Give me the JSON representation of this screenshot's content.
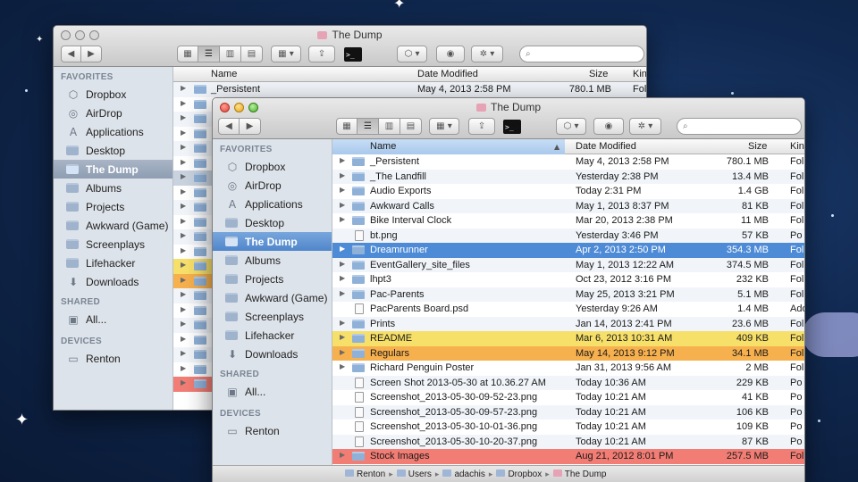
{
  "background": {
    "color": "#10284f",
    "star_color": "#ffffff"
  },
  "back_window": {
    "title": "The Dump",
    "toolbar": {
      "nav_back": "◀",
      "nav_fwd": "▶",
      "view_icons": "▦",
      "view_list": "☰",
      "view_columns": "▥",
      "view_flow": "▤",
      "arrange": "▦ ▾",
      "share": "⇪",
      "terminal": ">_",
      "dropbox": "⬡ ▾",
      "quicklook": "◉",
      "action": "✲ ▾",
      "search_placeholder": ""
    },
    "sidebar": {
      "favorites_header": "FAVORITES",
      "favorites": [
        {
          "label": "Dropbox",
          "icon": "dropbox-icon"
        },
        {
          "label": "AirDrop",
          "icon": "airdrop-icon"
        },
        {
          "label": "Applications",
          "icon": "applications-icon"
        },
        {
          "label": "Desktop",
          "icon": "desktop-icon"
        },
        {
          "label": "The Dump",
          "icon": "folder-icon",
          "selected": true
        },
        {
          "label": "Albums",
          "icon": "folder-icon"
        },
        {
          "label": "Projects",
          "icon": "folder-icon"
        },
        {
          "label": "Awkward (Game)",
          "icon": "folder-icon"
        },
        {
          "label": "Screenplays",
          "icon": "folder-icon"
        },
        {
          "label": "Lifehacker",
          "icon": "folder-icon"
        },
        {
          "label": "Downloads",
          "icon": "downloads-icon"
        }
      ],
      "shared_header": "SHARED",
      "shared": [
        {
          "label": "All...",
          "icon": "network-icon"
        }
      ],
      "devices_header": "DEVICES",
      "devices": [
        {
          "label": "Renton",
          "icon": "computer-icon"
        }
      ]
    },
    "columns": {
      "name": "Name",
      "date": "Date Modified",
      "size": "Size",
      "kind": "Kin"
    },
    "first_row": {
      "name": "_Persistent",
      "date": "May 4, 2013 2:58 PM",
      "size": "780.1 MB",
      "kind": "Fold"
    }
  },
  "front_window": {
    "title": "The Dump",
    "toolbar": {
      "nav_back": "◀",
      "nav_fwd": "▶",
      "view_icons": "▦",
      "view_list": "☰",
      "view_columns": "▥",
      "view_flow": "▤",
      "arrange": "▦ ▾",
      "share": "⇪",
      "terminal": ">_",
      "dropbox": "⬡ ▾",
      "quicklook": "◉",
      "action": "✲ ▾",
      "search_placeholder": ""
    },
    "sidebar": {
      "favorites_header": "FAVORITES",
      "favorites": [
        {
          "label": "Dropbox",
          "icon": "dropbox-icon"
        },
        {
          "label": "AirDrop",
          "icon": "airdrop-icon"
        },
        {
          "label": "Applications",
          "icon": "applications-icon"
        },
        {
          "label": "Desktop",
          "icon": "desktop-icon"
        },
        {
          "label": "The Dump",
          "icon": "folder-icon",
          "selected": true
        },
        {
          "label": "Albums",
          "icon": "folder-icon"
        },
        {
          "label": "Projects",
          "icon": "folder-icon"
        },
        {
          "label": "Awkward (Game)",
          "icon": "folder-icon"
        },
        {
          "label": "Screenplays",
          "icon": "folder-icon"
        },
        {
          "label": "Lifehacker",
          "icon": "folder-icon"
        },
        {
          "label": "Downloads",
          "icon": "downloads-icon"
        }
      ],
      "shared_header": "SHARED",
      "shared": [
        {
          "label": "All...",
          "icon": "network-icon"
        }
      ],
      "devices_header": "DEVICES",
      "devices": [
        {
          "label": "Renton",
          "icon": "computer-icon"
        }
      ]
    },
    "columns": {
      "name": "Name",
      "date": "Date Modified",
      "size": "Size",
      "kind": "Kin"
    },
    "rows": [
      {
        "name": "_Persistent",
        "date": "May 4, 2013 2:58 PM",
        "size": "780.1 MB",
        "kind": "Fol",
        "type": "folder",
        "expandable": true
      },
      {
        "name": "_The Landfill",
        "date": "Yesterday 2:38 PM",
        "size": "13.4 MB",
        "kind": "Fol",
        "type": "folder",
        "expandable": true
      },
      {
        "name": "Audio Exports",
        "date": "Today 2:31 PM",
        "size": "1.4 GB",
        "kind": "Fol",
        "type": "folder",
        "expandable": true
      },
      {
        "name": "Awkward Calls",
        "date": "May 1, 2013 8:37 PM",
        "size": "81 KB",
        "kind": "Fol",
        "type": "folder",
        "expandable": true
      },
      {
        "name": "Bike Interval Clock",
        "date": "Mar 20, 2013 2:38 PM",
        "size": "11 MB",
        "kind": "Fol",
        "type": "folder",
        "expandable": true
      },
      {
        "name": "bt.png",
        "date": "Yesterday 3:46 PM",
        "size": "57 KB",
        "kind": "Po",
        "type": "file",
        "expandable": false
      },
      {
        "name": "Dreamrunner",
        "date": "Apr 2, 2013 2:50 PM",
        "size": "354.3 MB",
        "kind": "Fol",
        "type": "folder",
        "expandable": true,
        "state": "sel"
      },
      {
        "name": "EventGallery_site_files",
        "date": "May 1, 2013 12:22 AM",
        "size": "374.5 MB",
        "kind": "Fol",
        "type": "folder",
        "expandable": true
      },
      {
        "name": "lhpt3",
        "date": "Oct 23, 2012 3:16 PM",
        "size": "232 KB",
        "kind": "Fol",
        "type": "folder",
        "expandable": true
      },
      {
        "name": "Pac-Parents",
        "date": "May 25, 2013 3:21 PM",
        "size": "5.1 MB",
        "kind": "Fol",
        "type": "folder",
        "expandable": true
      },
      {
        "name": "PacParents Board.psd",
        "date": "Yesterday 9:26 AM",
        "size": "1.4 MB",
        "kind": "Ado",
        "type": "file",
        "expandable": false
      },
      {
        "name": "Prints",
        "date": "Jan 14, 2013 2:41 PM",
        "size": "23.6 MB",
        "kind": "Fol",
        "type": "folder",
        "expandable": true
      },
      {
        "name": "README",
        "date": "Mar 6, 2013 10:31 AM",
        "size": "409 KB",
        "kind": "Fol",
        "type": "folder",
        "expandable": true,
        "state": "label-yellow"
      },
      {
        "name": "Regulars",
        "date": "May 14, 2013 9:12 PM",
        "size": "34.1 MB",
        "kind": "Fol",
        "type": "folder",
        "expandable": true,
        "state": "label-orange"
      },
      {
        "name": "Richard Penguin Poster",
        "date": "Jan 31, 2013 9:56 AM",
        "size": "2 MB",
        "kind": "Fol",
        "type": "folder",
        "expandable": true
      },
      {
        "name": "Screen Shot 2013-05-30 at 10.36.27 AM",
        "date": "Today 10:36 AM",
        "size": "229 KB",
        "kind": "Po",
        "type": "file",
        "expandable": false
      },
      {
        "name": "Screenshot_2013-05-30-09-52-23.png",
        "date": "Today 10:21 AM",
        "size": "41 KB",
        "kind": "Po",
        "type": "file",
        "expandable": false
      },
      {
        "name": "Screenshot_2013-05-30-09-57-23.png",
        "date": "Today 10:21 AM",
        "size": "106 KB",
        "kind": "Po",
        "type": "file",
        "expandable": false
      },
      {
        "name": "Screenshot_2013-05-30-10-01-36.png",
        "date": "Today 10:21 AM",
        "size": "109 KB",
        "kind": "Po",
        "type": "file",
        "expandable": false
      },
      {
        "name": "Screenshot_2013-05-30-10-20-37.png",
        "date": "Today 10:21 AM",
        "size": "87 KB",
        "kind": "Po",
        "type": "file",
        "expandable": false
      },
      {
        "name": "Stock Images",
        "date": "Aug 21, 2012 8:01 PM",
        "size": "257.5 MB",
        "kind": "Fol",
        "type": "folder",
        "expandable": true,
        "state": "label-red"
      }
    ],
    "pathbar": [
      "Renton",
      "Users",
      "adachis",
      "Dropbox",
      "The Dump"
    ]
  },
  "colors": {
    "selection": "#4e8bd6",
    "label_yellow": "#f7e06a",
    "label_orange": "#f7b04e",
    "label_red": "#f27d74",
    "sidebar_bg": "#dde3ea"
  }
}
